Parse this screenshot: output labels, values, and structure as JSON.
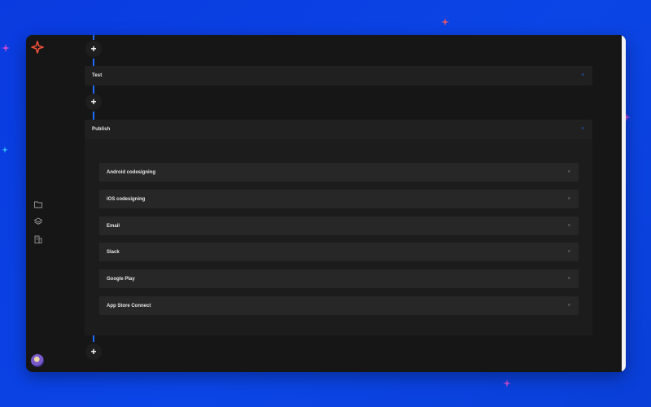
{
  "steps": {
    "test": {
      "label": "Test"
    },
    "publish": {
      "label": "Publish",
      "items": [
        {
          "label": "Android codesigning"
        },
        {
          "label": "iOS codesigning"
        },
        {
          "label": "Email"
        },
        {
          "label": "Slack"
        },
        {
          "label": "Google Play"
        },
        {
          "label": "App Store Connect"
        }
      ]
    }
  },
  "add_label": "+",
  "icons": {
    "logo": "codemagic-logo-icon",
    "nav": [
      "folder-icon",
      "layers-icon",
      "building-icon"
    ],
    "chevron_up": "chevron-up-icon",
    "chevron_down": "chevron-down-icon",
    "sparkle": "sparkle-icon"
  },
  "colors": {
    "background": "#0b45e6",
    "panel": "#161616",
    "accent": "#1f6bff",
    "sparkle_pink": "#e04dd0",
    "sparkle_cyan": "#35c8ff"
  }
}
